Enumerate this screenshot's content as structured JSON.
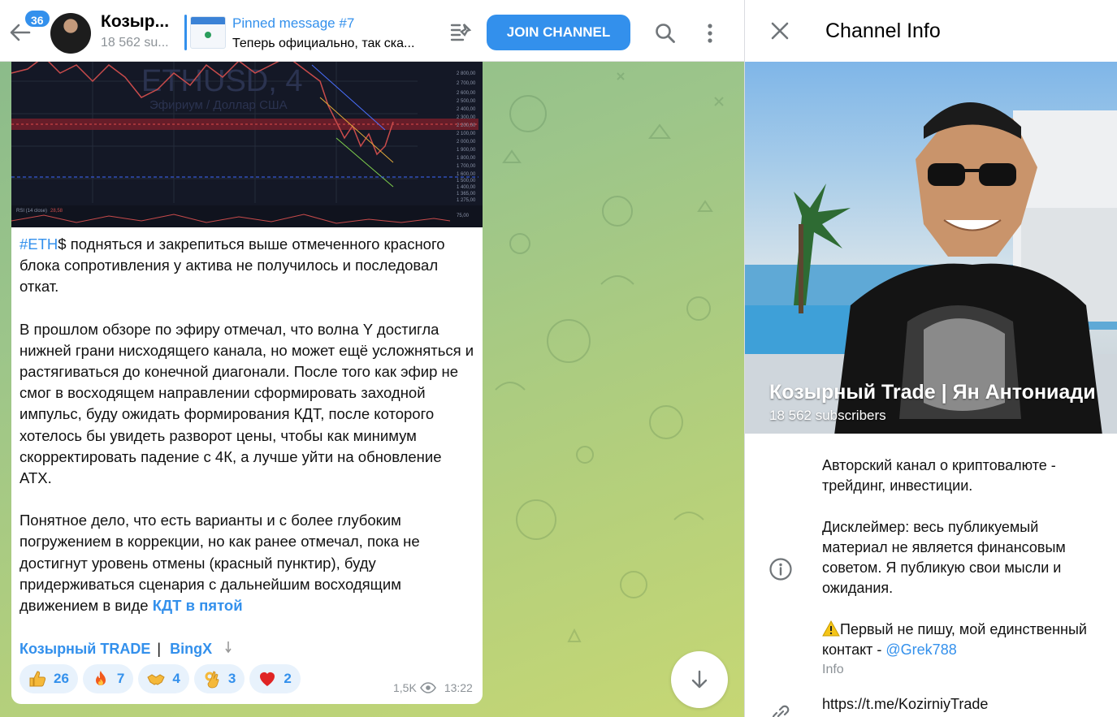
{
  "header": {
    "unread_count": "36",
    "channel_title": "Козыр...",
    "channel_subscribers": "18 562 su...",
    "pinned_label": "Pinned message #7",
    "pinned_text": "Теперь официально, так ска...",
    "join_label": "JOIN CHANNEL"
  },
  "message": {
    "hashtag": "#ETH",
    "p1_rest": "$ подняться и закрепиться выше отмеченного красного блока сопротивления у актива не получилось и последовал откат.",
    "p2": "В прошлом обзоре по эфиру отмечал, что волна Y достигла нижней грани нисходящего канала, но может ещё усложняться и растягиваться до конечной диагонали. После того как эфир не смог в восходящем направлении сформировать заходной импульс, буду ожидать формирования КДТ, после которого хотелось бы увидеть разворот цены, чтобы как минимум скорректировать падение с 4К, а лучше уйти на обновление ATX.",
    "p3_before": "Понятное дело, что есть варианты и с более глубоким погружением в коррекции, но как ранее отмечал, пока не достигнут уровень отмены (красный пунктир), буду придерживаться сценария с дальнейшим восходящим движением в виде ",
    "p3_link": "КДТ в пятой",
    "link_trade": "Козырный TRADE",
    "link_sep": "|",
    "link_bingx": "BingX",
    "views": "1,5K",
    "time": "13:22",
    "reactions": [
      {
        "emoji": "thumbs-up",
        "count": "26"
      },
      {
        "emoji": "fire",
        "count": "7"
      },
      {
        "emoji": "handshake",
        "count": "4"
      },
      {
        "emoji": "ok-hand",
        "count": "3"
      },
      {
        "emoji": "heart",
        "count": "2"
      }
    ]
  },
  "info_panel": {
    "title": "Channel Info",
    "channel_name": "Козырный Trade | Ян Антониади",
    "subscribers": "18 562 subscribers",
    "description_p1": "Авторский канал о криптовалюте - трейдинг, инвестиции.",
    "description_p2": "Дисклеймер: весь публикуемый материал не является финансовым советом. Я публикую свои мысли и ожидания.",
    "description_p3": "Первый не пишу, мой единственный контакт - ",
    "contact": "@Grek788",
    "caption": "Info",
    "link": "https://t.me/KozirniyTrade"
  },
  "chart_image": {
    "watermark": "ETHUSD, 4",
    "watermark_sub": "Эфириум / Доллар США",
    "price_ticks": [
      "2 800,00",
      "2 700,00",
      "2 600,00",
      "2 500,00",
      "2 400,00",
      "2 300,00",
      "2 200,00",
      "2 100,00",
      "2 000,00",
      "1 900,00",
      "1 800,00",
      "1 700,00",
      "1 600,00",
      "1 500,00",
      "1 400,00",
      "1 365,00",
      "1 275,00"
    ],
    "rsi_label": "RSI (14 close)",
    "rsi_value": "28,58",
    "rsi_tick": "75,00"
  },
  "colors": {
    "accent": "#3390ec",
    "chart_bg": "#141826",
    "resistance": "#e04a4a"
  }
}
